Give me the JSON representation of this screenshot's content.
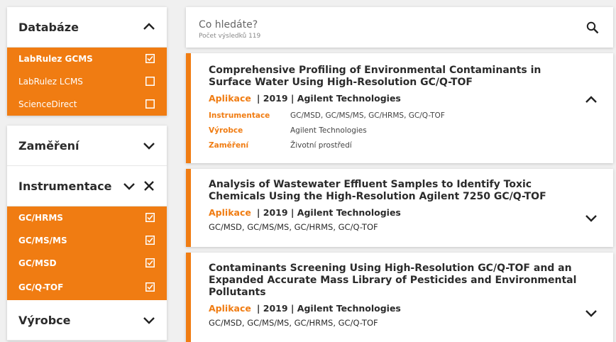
{
  "sidebar": {
    "databaze": {
      "title": "Databáze",
      "options": [
        {
          "label": "LabRulez GCMS",
          "checked": true
        },
        {
          "label": "LabRulez LCMS",
          "checked": false
        },
        {
          "label": "ScienceDirect",
          "checked": false
        }
      ]
    },
    "zamereni": {
      "title": "Zaměření"
    },
    "instrumentace": {
      "title": "Instrumentace",
      "options": [
        {
          "label": "GC/HRMS",
          "checked": true
        },
        {
          "label": "GC/MS/MS",
          "checked": true
        },
        {
          "label": "GC/MSD",
          "checked": true
        },
        {
          "label": "GC/Q-TOF",
          "checked": true
        }
      ]
    },
    "vyrobce": {
      "title": "Výrobce"
    }
  },
  "search": {
    "placeholder": "Co hledáte?",
    "count_label": "Počet výsledků 119"
  },
  "results": [
    {
      "title": "Comprehensive Profiling of Environmental Contaminants in Surface Water Using High-Resolution GC/Q-TOF",
      "type": "Aplikace",
      "meta": "| 2019 | Agilent Technologies",
      "expanded": true,
      "details": [
        {
          "key": "Instrumentace",
          "value": "GC/MSD, GC/MS/MS, GC/HRMS, GC/Q-TOF"
        },
        {
          "key": "Výrobce",
          "value": "Agilent Technologies"
        },
        {
          "key": "Zaměření",
          "value": "Životní prostředí"
        }
      ]
    },
    {
      "title": "Analysis of Wastewater Effluent Samples to Identify Toxic Chemicals Using the High-Resolution Agilent 7250 GC/Q-TOF",
      "type": "Aplikace",
      "meta": "| 2019 | Agilent Technologies",
      "expanded": false,
      "instruments": "GC/MSD, GC/MS/MS, GC/HRMS, GC/Q-TOF"
    },
    {
      "title": "Contaminants Screening Using High-Resolution GC/Q-TOF and an Expanded Accurate Mass Library of Pesticides and Environmental Pollutants",
      "type": "Aplikace",
      "meta": "| 2019 | Agilent Technologies",
      "expanded": false,
      "instruments": "GC/MSD, GC/MS/MS, GC/HRMS, GC/Q-TOF"
    }
  ],
  "colors": {
    "accent": "#f07c12",
    "text": "#2b2b2b",
    "background": "#f0f0f0"
  },
  "icons": [
    "chevron-up-icon",
    "chevron-down-icon",
    "close-icon",
    "checkbox-checked-icon",
    "checkbox-empty-icon",
    "search-icon"
  ]
}
